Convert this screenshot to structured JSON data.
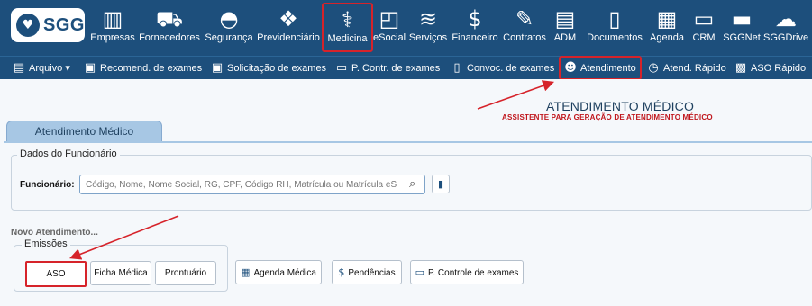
{
  "header": {
    "logo_text": "SGG",
    "modules": [
      {
        "label": "Empresas",
        "icon": "building-icon"
      },
      {
        "label": "Fornecedores",
        "icon": "truck-icon"
      },
      {
        "label": "Segurança",
        "icon": "hard-hat-icon"
      },
      {
        "label": "Previdenciário",
        "icon": "handshake-icon"
      },
      {
        "label": "Medicina",
        "icon": "stethoscope-icon"
      },
      {
        "label": "eSocial",
        "icon": "esocial-icon"
      },
      {
        "label": "Serviços",
        "icon": "layers-icon"
      },
      {
        "label": "Financeiro",
        "icon": "money-bag-icon"
      },
      {
        "label": "Contratos",
        "icon": "contract-icon"
      },
      {
        "label": "ADM",
        "icon": "folder-icon"
      },
      {
        "label": "Documentos",
        "icon": "document-icon"
      },
      {
        "label": "Agenda",
        "icon": "calendar-icon"
      },
      {
        "label": "CRM",
        "icon": "crm-icon"
      },
      {
        "label": "SGGNet",
        "icon": "net-icon"
      },
      {
        "label": "SGGDrive",
        "icon": "drive-icon"
      }
    ],
    "active_module": "Medicina"
  },
  "subnav": {
    "items": [
      {
        "label": "Arquivo ▾",
        "icon": "folder-icon"
      },
      {
        "label": "Recomend. de exames",
        "icon": "clipboard-icon"
      },
      {
        "label": "Solicitação de exames",
        "icon": "clipboard-icon"
      },
      {
        "label": "P. Contr. de exames",
        "icon": "presentation-icon"
      },
      {
        "label": "Convoc. de exames",
        "icon": "file-icon"
      },
      {
        "label": "Atendimento",
        "icon": "doctor-icon"
      },
      {
        "label": "Atend. Rápido",
        "icon": "stopwatch-icon"
      },
      {
        "label": "ASO Rápido",
        "icon": "aso-icon"
      }
    ],
    "active_item": "Atendimento"
  },
  "page": {
    "title": "ATENDIMENTO MÉDICO",
    "subtitle": "ASSISTENTE PARA GERAÇÃO DE ATENDIMENTO MÉDICO",
    "tab_label": "Atendimento Médico"
  },
  "employee": {
    "section_label": "Dados do Funcionário",
    "field_label": "Funcionário:",
    "placeholder": "Código, Nome, Nome Social, RG, CPF, Código RH, Matrícula ou Matrícula eS"
  },
  "new_service": {
    "label": "Novo Atendimento...",
    "emissions_label": "Emissões",
    "emission_buttons": [
      "ASO",
      "Ficha Médica",
      "Prontuário"
    ],
    "action_buttons": [
      {
        "label": "Agenda Médica",
        "icon": "calendar-icon"
      },
      {
        "label": "Pendências",
        "icon": "dollar-doc-icon"
      },
      {
        "label": "P. Controle de exames",
        "icon": "presentation-icon"
      }
    ]
  },
  "colors": {
    "header_bg": "#1d4f7c",
    "highlight_red": "#d6232a",
    "tab_bg": "#a7c7e4"
  }
}
